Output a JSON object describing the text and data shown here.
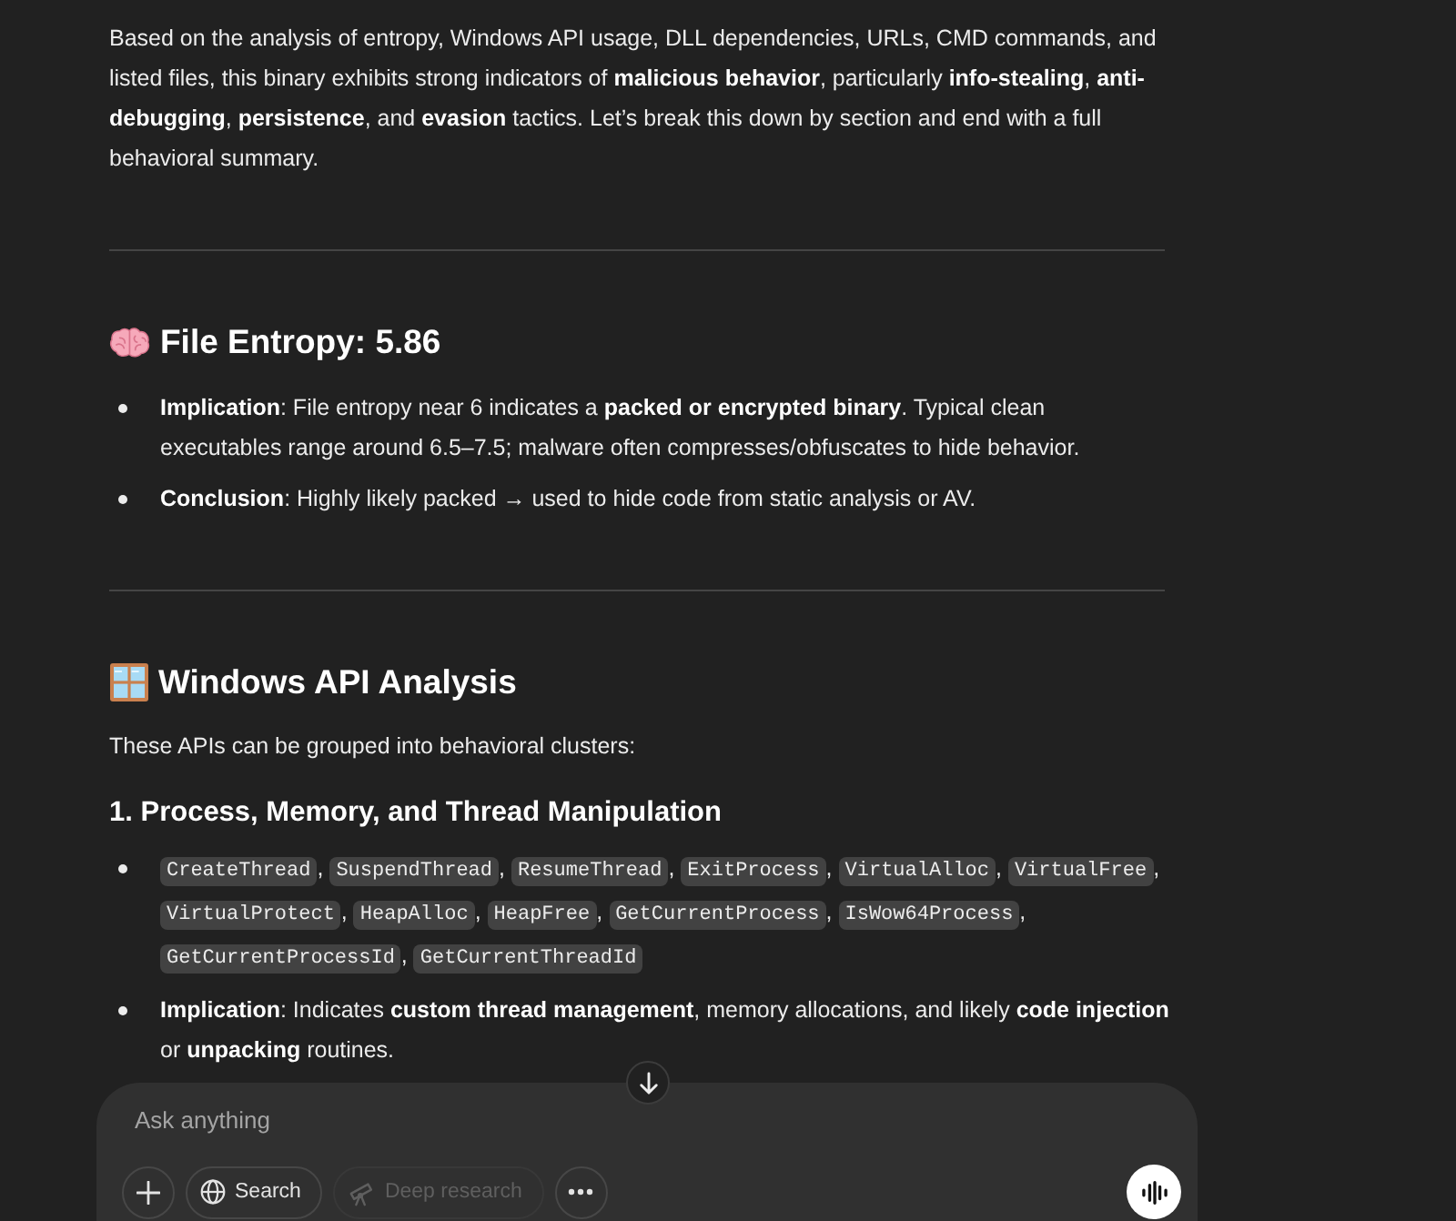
{
  "intro": "Based on the analysis of entropy, Windows API usage, DLL dependencies, URLs, CMD commands, and listed files, this binary exhibits strong indicators of **malicious behavior**, particularly **info-stealing**, **anti-debugging**, **persistence**, and **evasion** tactics. Let’s break this down by section and end with a full behavioral summary.",
  "sections": [
    {
      "title": "File Entropy: 5.86",
      "blocks": [
        {
          "kind": "bullets",
          "items": [
            {
              "kind": "text",
              "text": "**Implication**: File entropy near 6 indicates a **packed or encrypted binary**. Typical clean executables range around 6.5–7.5; malware often compresses/obfuscates to hide behavior."
            },
            {
              "kind": "text",
              "text": "**Conclusion**: Highly likely packed → used to hide code from static analysis or AV."
            }
          ]
        }
      ]
    },
    {
      "title": "Windows API Analysis",
      "blocks": [
        {
          "kind": "paragraph",
          "text": "These APIs can be grouped into behavioral clusters:"
        },
        {
          "kind": "subheading",
          "text": "1. Process, Memory, and Thread Manipulation"
        },
        {
          "kind": "bullets",
          "items": [
            {
              "kind": "code_list",
              "separator": ",",
              "codes": [
                "CreateThread",
                "SuspendThread",
                "ResumeThread",
                "ExitProcess",
                "VirtualAlloc",
                "VirtualFree",
                "VirtualProtect",
                "HeapAlloc",
                "HeapFree",
                "GetCurrentProcess",
                "IsWow64Process",
                "GetCurrentProcessId",
                "GetCurrentThreadId"
              ]
            },
            {
              "kind": "text",
              "text": "**Implication**: Indicates **custom thread management**, memory allocations, and likely **code injection** or **unpacking** routines."
            }
          ]
        }
      ]
    }
  ],
  "composer": {
    "placeholder": "Ask anything",
    "tools": [
      {
        "label": "Search",
        "disabled": false
      },
      {
        "label": "Deep research",
        "disabled": true
      }
    ]
  }
}
